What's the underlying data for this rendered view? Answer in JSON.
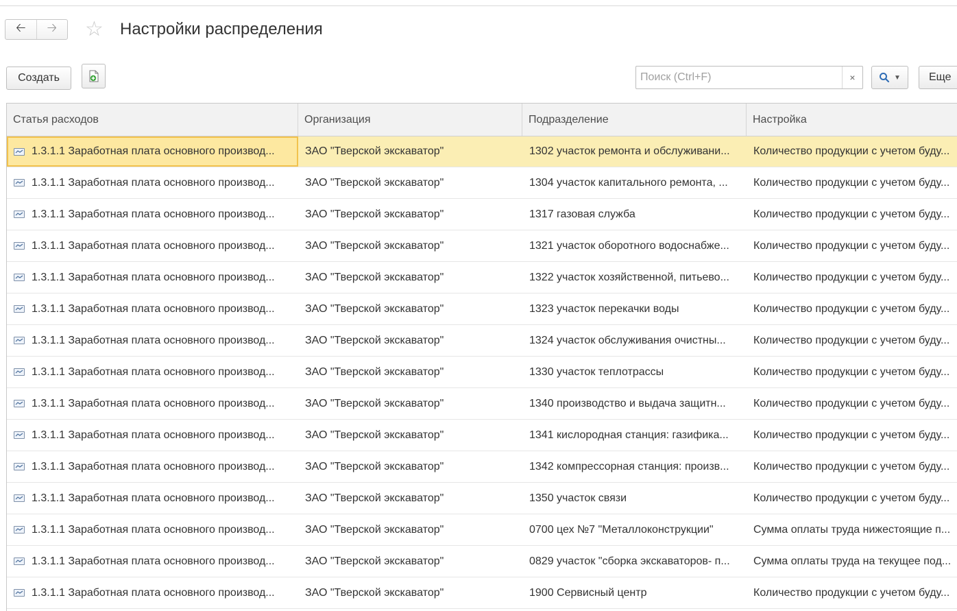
{
  "title": "Настройки распределения",
  "nav": {
    "back_icon": "arrow-left-icon",
    "forward_icon": "arrow-right-icon",
    "favorite_icon": "star-icon"
  },
  "toolbar": {
    "create_label": "Создать",
    "copy_icon": "add-document-icon",
    "search_placeholder": "Поиск (Ctrl+F)",
    "search_clear": "×",
    "search_icon": "search-icon",
    "more_label": "Еще"
  },
  "table": {
    "columns": [
      "Статья расходов",
      "Организация",
      "Подразделение",
      "Настройка"
    ],
    "selected_row": 0,
    "rows": [
      {
        "article": "1.3.1.1 Заработная плата основного производ...",
        "org": "ЗАО \"Тверской экскаватор\"",
        "dept": "1302 участок ремонта и обслуживани...",
        "setting": "Количество продукции с учетом буду..."
      },
      {
        "article": "1.3.1.1 Заработная плата основного производ...",
        "org": "ЗАО \"Тверской экскаватор\"",
        "dept": "1304 участок капитального ремонта, ...",
        "setting": "Количество продукции с учетом буду..."
      },
      {
        "article": "1.3.1.1 Заработная плата основного производ...",
        "org": "ЗАО \"Тверской экскаватор\"",
        "dept": "1317 газовая служба",
        "setting": "Количество продукции с учетом буду..."
      },
      {
        "article": "1.3.1.1 Заработная плата основного производ...",
        "org": "ЗАО \"Тверской экскаватор\"",
        "dept": "1321 участок оборотного водоснабже...",
        "setting": "Количество продукции с учетом буду..."
      },
      {
        "article": "1.3.1.1 Заработная плата основного производ...",
        "org": "ЗАО \"Тверской экскаватор\"",
        "dept": "1322 участок хозяйственной, питьево...",
        "setting": "Количество продукции с учетом буду..."
      },
      {
        "article": "1.3.1.1 Заработная плата основного производ...",
        "org": "ЗАО \"Тверской экскаватор\"",
        "dept": "1323 участок перекачки воды",
        "setting": "Количество продукции с учетом буду..."
      },
      {
        "article": "1.3.1.1 Заработная плата основного производ...",
        "org": "ЗАО \"Тверской экскаватор\"",
        "dept": "1324 участок обслуживания очистны...",
        "setting": "Количество продукции с учетом буду..."
      },
      {
        "article": "1.3.1.1 Заработная плата основного производ...",
        "org": "ЗАО \"Тверской экскаватор\"",
        "dept": "1330 участок теплотрассы",
        "setting": "Количество продукции с учетом буду..."
      },
      {
        "article": "1.3.1.1 Заработная плата основного производ...",
        "org": "ЗАО \"Тверской экскаватор\"",
        "dept": "1340 производство и выдача защитн...",
        "setting": "Количество продукции с учетом буду..."
      },
      {
        "article": "1.3.1.1 Заработная плата основного производ...",
        "org": "ЗАО \"Тверской экскаватор\"",
        "dept": "1341 кислородная станция: газифика...",
        "setting": "Количество продукции с учетом буду..."
      },
      {
        "article": "1.3.1.1 Заработная плата основного производ...",
        "org": "ЗАО \"Тверской экскаватор\"",
        "dept": "1342 компрессорная станция: произв...",
        "setting": "Количество продукции с учетом буду..."
      },
      {
        "article": "1.3.1.1 Заработная плата основного производ...",
        "org": "ЗАО \"Тверской экскаватор\"",
        "dept": "1350 участок связи",
        "setting": "Количество продукции с учетом буду..."
      },
      {
        "article": "1.3.1.1 Заработная плата основного производ...",
        "org": "ЗАО \"Тверской экскаватор\"",
        "dept": "0700 цех №7 \"Металлоконструкции\"",
        "setting": "Сумма оплаты труда нижестоящие п..."
      },
      {
        "article": "1.3.1.1 Заработная плата основного производ...",
        "org": "ЗАО \"Тверской экскаватор\"",
        "dept": "0829 участок \"сборка экскаваторов- п...",
        "setting": "Сумма оплаты труда на текущее под..."
      },
      {
        "article": "1.3.1.1 Заработная плата основного производ...",
        "org": "ЗАО \"Тверской экскаватор\"",
        "dept": "1900 Сервисный центр",
        "setting": "Количество продукции с учетом буду..."
      }
    ]
  }
}
